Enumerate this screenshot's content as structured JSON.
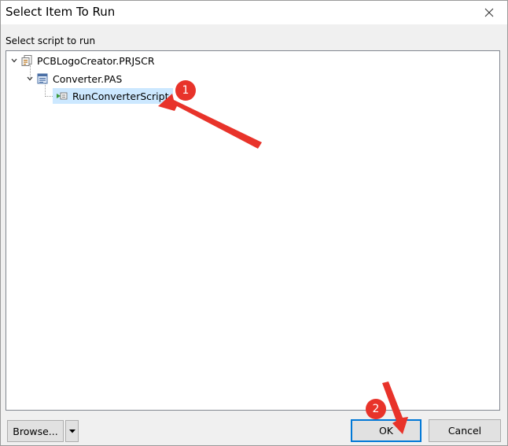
{
  "window": {
    "title": "Select Item To Run",
    "close_icon": "close-icon"
  },
  "prompt": "Select script to run",
  "tree": {
    "root": {
      "label": "PCBLogoCreator.PRJSCR",
      "icon": "script-project-icon",
      "expanded": true
    },
    "child": {
      "label": "Converter.PAS",
      "icon": "pascal-file-icon",
      "expanded": true
    },
    "leaf": {
      "label": "RunConverterScript",
      "icon": "run-procedure-icon",
      "selected": true
    }
  },
  "buttons": {
    "browse": "Browse...",
    "browse_dropdown_icon": "triangle-down-icon",
    "ok": "OK",
    "cancel": "Cancel"
  },
  "annotations": {
    "badge_1": "1",
    "badge_2": "2",
    "color": "#e8332a"
  },
  "colors": {
    "selection": "#cce8ff",
    "default_button_border": "#0078d7"
  }
}
